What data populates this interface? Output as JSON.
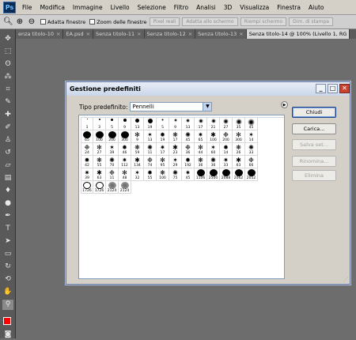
{
  "menubar": {
    "logo": "Ps",
    "items": [
      "File",
      "Modifica",
      "Immagine",
      "Livello",
      "Selezione",
      "Filtro",
      "Analisi",
      "3D",
      "Visualizza",
      "Finestra",
      "Aiuto"
    ]
  },
  "options": {
    "adapt_window_label": "Adatta finestre",
    "zoom_all_label": "Zoom delle finestre",
    "buttons": [
      "Pixel reali",
      "Adatta allo schermo",
      "Riempi schermo",
      "Dim. di stampa"
    ]
  },
  "tabs": [
    {
      "label": "enza titolo-10",
      "close": "×"
    },
    {
      "label": "EA.psd",
      "close": "×"
    },
    {
      "label": "Senza titolo-11",
      "close": "×"
    },
    {
      "label": "Senza titolo-12",
      "close": "×"
    },
    {
      "label": "Senza titolo-13",
      "close": "×"
    },
    {
      "label": "Senza titolo-14 @ 100% (Livello 1, RG",
      "close": ""
    }
  ],
  "colors": {
    "foreground": "#ff0000",
    "background": "#ffffff",
    "dialog_bg": "#d4d0c8"
  },
  "dialog": {
    "title": "Gestione predefiniti",
    "type_label": "Tipo predefinito:",
    "type_value": "Pennelli",
    "buttons": {
      "close": "Chiudi",
      "load": "Carica...",
      "save": "Salva set...",
      "rename": "Rinomina...",
      "delete": "Elimina"
    },
    "brushes": [
      [
        "1",
        "3",
        "5",
        "9",
        "13",
        "19",
        "5",
        "9",
        "13",
        "17",
        "21",
        "27",
        "35",
        "45"
      ],
      [
        "65",
        "100",
        "200",
        "300",
        "9",
        "13",
        "19",
        "17",
        "45",
        "65",
        "100",
        "200",
        "300",
        "14"
      ],
      [
        "24",
        "27",
        "39",
        "46",
        "59",
        "11",
        "17",
        "23",
        "36",
        "44",
        "60",
        "14",
        "26",
        "33"
      ],
      [
        "42",
        "55",
        "70",
        "112",
        "134",
        "74",
        "95",
        "29",
        "192",
        "36",
        "36",
        "33",
        "63",
        "66"
      ],
      [
        "39",
        "63",
        "11",
        "48",
        "32",
        "55",
        "100",
        "75",
        "45",
        "1106",
        "2500",
        "2088",
        "2062",
        "2052"
      ],
      [
        "1726",
        "1726",
        "2124",
        "2124"
      ]
    ]
  }
}
